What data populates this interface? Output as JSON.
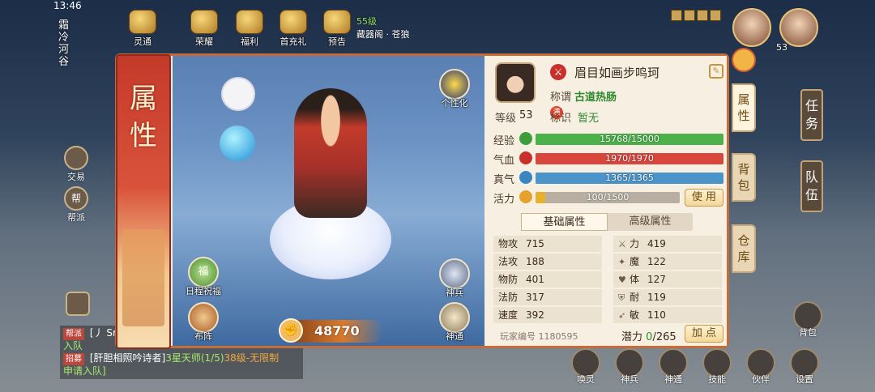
{
  "status": {
    "time": "13:46"
  },
  "top_icons": [
    {
      "label": "灵通",
      "name": "lingtong"
    },
    {
      "label": "荣耀",
      "name": "rongyao"
    },
    {
      "label": "福利",
      "name": "fuli"
    },
    {
      "label": "首充礼",
      "name": "shouchongli"
    },
    {
      "label": "预告",
      "name": "yugao"
    }
  ],
  "preview": {
    "level": "55级",
    "reward": "藏器阁 · 苍狼"
  },
  "location": "霜冷河谷",
  "party_avatar_level": "53",
  "left_buttons": {
    "trade": "交易",
    "faction": "帮派",
    "faction_glyph": "帮"
  },
  "chat": {
    "line1_tag": "帮派",
    "line1_text": "[丿 Sr",
    "line1_cont": "入队",
    "line2_tag": "招募",
    "line2_name": "[肝胆相照吟诗者]",
    "line2_mid": "3星天师(1/5)",
    "line2_level": "38级-无限制",
    "line2_end": "申请入队]"
  },
  "right_side": {
    "task": "任务",
    "team": "队伍"
  },
  "bottom_bar": [
    {
      "label": "唤灵"
    },
    {
      "label": "神兵"
    },
    {
      "label": "神通"
    },
    {
      "label": "技能"
    },
    {
      "label": "伙伴"
    },
    {
      "label": "设置"
    }
  ],
  "backpack_label": "背包",
  "panel": {
    "banner_title": "属性",
    "viewport_buttons": {
      "personalize": "个性化",
      "blessing": "日程祝福",
      "blessing_glyph": "福",
      "formation": "布阵",
      "weapon": "神兵",
      "divine": "神通"
    },
    "combat_power": "48770",
    "character": {
      "name": "眉目如画步鸣珂",
      "title_label": "称谓",
      "title_value": "古道热肠",
      "level_label": "等级",
      "level_value": "53",
      "level_badge": "满",
      "mark_label": "标识",
      "mark_value": "暂无"
    },
    "bars": [
      {
        "label": "经验",
        "text": "15768/15000",
        "ratio": 1.0,
        "color": "#4cb14a",
        "icon_color": "#3f9e3c"
      },
      {
        "label": "气血",
        "text": "1970/1970",
        "ratio": 1.0,
        "color": "#d9463c",
        "icon_color": "#c9302c"
      },
      {
        "label": "真气",
        "text": "1365/1365",
        "ratio": 1.0,
        "color": "#4a94c9",
        "icon_color": "#3a86c2"
      },
      {
        "label": "活力",
        "text": "100/1500",
        "ratio": 0.0667,
        "color": "#e6b22c",
        "icon_color": "#e6a22c"
      }
    ],
    "use_button": "使 用",
    "tabs": {
      "basic": "基础属性",
      "advanced": "高级属性"
    },
    "stats_left": [
      {
        "label": "物攻",
        "value": "715"
      },
      {
        "label": "法攻",
        "value": "188"
      },
      {
        "label": "物防",
        "value": "401"
      },
      {
        "label": "法防",
        "value": "317"
      },
      {
        "label": "速度",
        "value": "392"
      }
    ],
    "stats_right": [
      {
        "label": "力",
        "value": "419",
        "icon": "⚔"
      },
      {
        "label": "魔",
        "value": "122",
        "icon": "✦"
      },
      {
        "label": "体",
        "value": "127",
        "icon": "♥"
      },
      {
        "label": "耐",
        "value": "119",
        "icon": "⛨"
      },
      {
        "label": "敏",
        "value": "110",
        "icon": "➶"
      }
    ],
    "player_id_label": "玩家编号",
    "player_id": "1180595",
    "potential_label": "潜力",
    "potential_current": "0",
    "potential_total": "/265",
    "add_button": "加 点",
    "side_tabs": {
      "attr": "属性",
      "bag": "背包",
      "warehouse": "仓库"
    }
  }
}
